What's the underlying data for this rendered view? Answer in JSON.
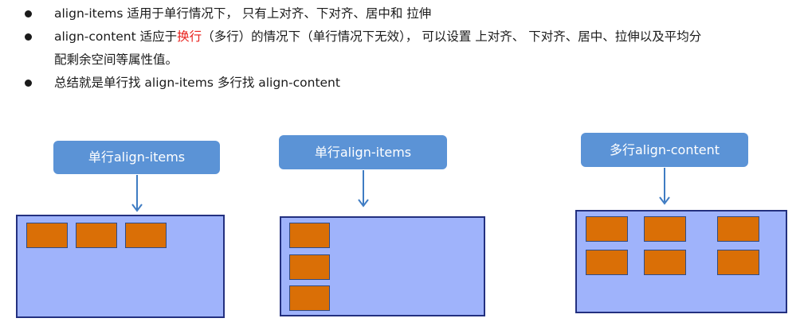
{
  "bullets": [
    {
      "text": "align-items  适用于单行情况下， 只有上对齐、下对齐、居中和 拉伸"
    },
    {
      "pre": "align-content 适应于",
      "highlight": "换行",
      "post": "（多行）的情况下（单行情况下无效）， 可以设置 上对齐、 下对齐、居中、拉伸以及平均分",
      "line2": "配剩余空间等属性值。"
    },
    {
      "text": "总结就是单行找 align-items  多行找 align-content"
    }
  ],
  "diagrams": [
    {
      "label": "单行align-items",
      "items": 3
    },
    {
      "label": "单行align-items",
      "items": 3
    },
    {
      "label": "多行align-content",
      "items": 6
    }
  ],
  "colors": {
    "label_bg": "#5b93d6",
    "container_bg": "#9fb3fb",
    "container_border": "#23307f",
    "item_bg": "#da6f06",
    "arrow": "#3f7cc3",
    "highlight": "#e8211c"
  }
}
